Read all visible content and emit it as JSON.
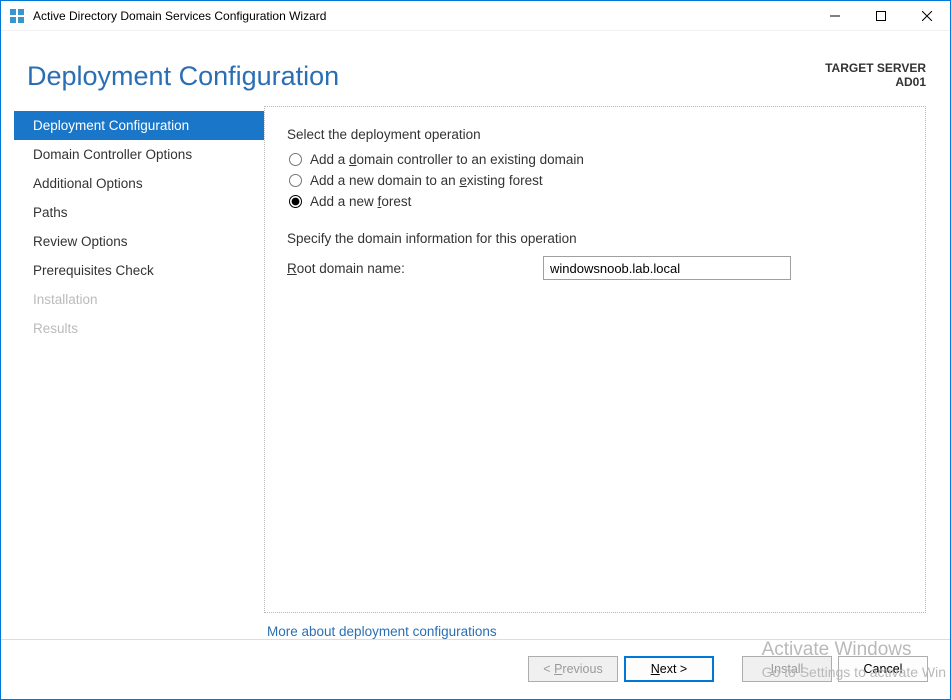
{
  "titlebar": {
    "title": "Active Directory Domain Services Configuration Wizard"
  },
  "page_title": "Deployment Configuration",
  "target": {
    "label": "TARGET SERVER",
    "name": "AD01"
  },
  "sidebar": {
    "items": [
      {
        "label": "Deployment Configuration",
        "selected": true,
        "enabled": true
      },
      {
        "label": "Domain Controller Options",
        "selected": false,
        "enabled": true
      },
      {
        "label": "Additional Options",
        "selected": false,
        "enabled": true
      },
      {
        "label": "Paths",
        "selected": false,
        "enabled": true
      },
      {
        "label": "Review Options",
        "selected": false,
        "enabled": true
      },
      {
        "label": "Prerequisites Check",
        "selected": false,
        "enabled": true
      },
      {
        "label": "Installation",
        "selected": false,
        "enabled": false
      },
      {
        "label": "Results",
        "selected": false,
        "enabled": false
      }
    ]
  },
  "content": {
    "section1_title": "Select the deployment operation",
    "radios": [
      {
        "label_pre": "Add a ",
        "underline": "d",
        "label_post": "omain controller to an existing domain",
        "checked": false
      },
      {
        "label_pre": "Add a new domain to an ",
        "underline": "e",
        "label_post": "xisting forest",
        "checked": false
      },
      {
        "label_pre": "Add a new ",
        "underline": "f",
        "label_post": "orest",
        "checked": true
      }
    ],
    "section2_title": "Specify the domain information for this operation",
    "root_domain_label_pre": "",
    "root_domain_underline": "R",
    "root_domain_label_post": "oot domain name:",
    "root_domain_value": "windowsnoob.lab.local",
    "more_link": "More about deployment configurations"
  },
  "footer": {
    "previous_pre": "< ",
    "previous_u": "P",
    "previous_post": "revious",
    "next_u": "N",
    "next_post": "ext >",
    "install_u": "I",
    "install_post": "nstall",
    "cancel": "Cancel"
  },
  "watermark": {
    "line1": "Activate Windows",
    "line2": "Go to Settings to activate Win"
  }
}
